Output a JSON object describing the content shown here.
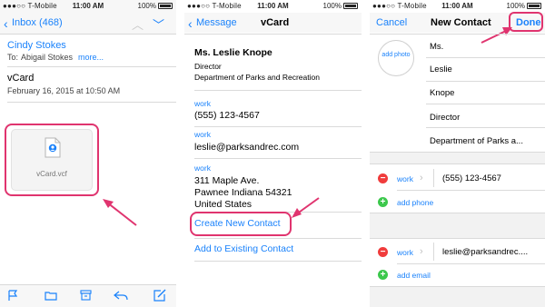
{
  "status_bar": {
    "carrier": "●●●○○ T-Mobile",
    "time": "11:00 AM",
    "battery": "100%"
  },
  "mail": {
    "back_label": "Inbox (468)",
    "sender": "Cindy Stokes",
    "to_label": "To:",
    "recipient": "Abigail Stokes",
    "more_link": "more...",
    "subject": "vCard",
    "date": "February 16, 2015 at 10:50 AM",
    "attachment_name": "vCard.vcf"
  },
  "vcard": {
    "back_label": "Message",
    "title": "vCard",
    "name": "Ms. Leslie Knope",
    "job_title": "Director",
    "department": "Department of Parks and Recreation",
    "phone_label": "work",
    "phone": "(555) 123-4567",
    "email_label": "work",
    "email": "leslie@parksandrec.com",
    "address_label": "work",
    "address_line1": "311 Maple Ave.",
    "address_line2": "Pawnee Indiana 54321",
    "address_line3": "United States",
    "create_label": "Create New Contact",
    "add_existing_label": "Add to Existing Contact"
  },
  "new_contact": {
    "cancel_label": "Cancel",
    "title": "New Contact",
    "done_label": "Done",
    "add_photo": "add photo",
    "prefix": "Ms.",
    "first_name": "Leslie",
    "last_name": "Knope",
    "job_title": "Director",
    "company": "Department of Parks a...",
    "phone_label": "work",
    "phone_value": "(555) 123-4567",
    "add_phone": "add phone",
    "email_label": "work",
    "email_value": "leslie@parksandrec....",
    "add_email": "add email"
  },
  "colors": {
    "accent": "#1a82fb",
    "callout": "#e0346f",
    "remove": "#f03c3c",
    "add": "#3cc84c"
  }
}
